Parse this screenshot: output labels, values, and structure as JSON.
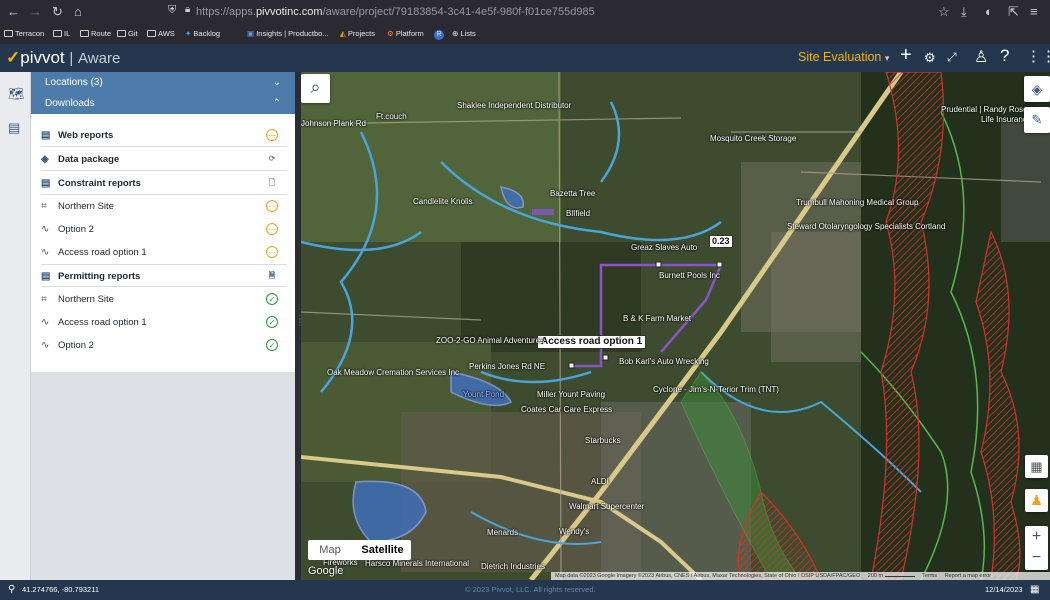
{
  "browser": {
    "url_prefix": "https://apps.",
    "url_host": "pivvotinc.com",
    "url_path": "/aware/project/79183854-3c41-4e5f-980f-f01ce755d985",
    "bookmarks": [
      "Terracon",
      "IL",
      "Route",
      "Git",
      "AWS",
      "Backlog",
      "Insights | Productbo...",
      "Projects",
      "Platform",
      "Lists"
    ]
  },
  "app": {
    "brand": "pivvot",
    "product": "Aware",
    "context": "Site Evaluation"
  },
  "sidebar": {
    "locations_label": "Locations (3)",
    "downloads_label": "Downloads",
    "sections": [
      {
        "title": "Web reports",
        "status": "pending"
      },
      {
        "title": "Data package",
        "status": "refresh"
      },
      {
        "title": "Constraint reports",
        "status": "doc"
      },
      {
        "item": "Northern Site",
        "status": "pending"
      },
      {
        "item": "Option 2",
        "status": "pending"
      },
      {
        "item": "Access road option 1",
        "status": "pending"
      },
      {
        "title": "Permitting reports",
        "status": "doc"
      },
      {
        "item": "Northern Site",
        "status": "done"
      },
      {
        "item": "Access road option 1",
        "status": "done"
      },
      {
        "item": "Option 2",
        "status": "done"
      }
    ]
  },
  "map": {
    "route_label": "Access road option 1",
    "distance_label": "0.23",
    "map_type_map": "Map",
    "map_type_satellite": "Satellite",
    "google": "Google",
    "attribution": "Map data ©2023 Google Imagery ©2023 Airbus, CNES / Airbus, Maxar Technologies, State of Ohio / OSIP USDA/FPAC/GEO",
    "scale": "200 m",
    "terms": "Terms",
    "report": "Report a map error",
    "pois": [
      "Shaklee Independent Distributor",
      "Ft.couch",
      "Prudential | Randy Roscoe",
      "Bazetta Tree",
      "Candlelite Knolls",
      "Mosquito Creek Storage",
      "Trumbull Mahoning Medical Group",
      "Steward Otolaryngology Specialists Cortland",
      "Greaz Slaves Auto",
      "Burnett Pools Inc",
      "B & K Farm Market",
      "ZOO-2-GO Animal Adventures",
      "Bob Karl's Auto Wrecking",
      "Perkins Jones Rd NE",
      "Miller Yount Paving",
      "Cyclone - Jim's-N-Terior Trim (TNT)",
      "Coates Car Care Express",
      "Starbucks",
      "ALDI",
      "Walmart Supercenter",
      "Menards",
      "Wendy's",
      "Oak Meadow Cremation Services Inc",
      "Harsco Minerals International",
      "Dietrich Industries",
      "Johnson Plank Rd",
      "Yount Pond",
      "BlIfield",
      "Life Insurance",
      "Fireworks"
    ]
  },
  "footer": {
    "coords": "41.274766, -80.793211",
    "copyright": "© 2023 Pivvot, LLC. All rights reserved.",
    "date": "12/14/2023"
  },
  "colors": {
    "header": "#24374f",
    "accent": "#f5b400",
    "accordion": "#4d7cab"
  }
}
